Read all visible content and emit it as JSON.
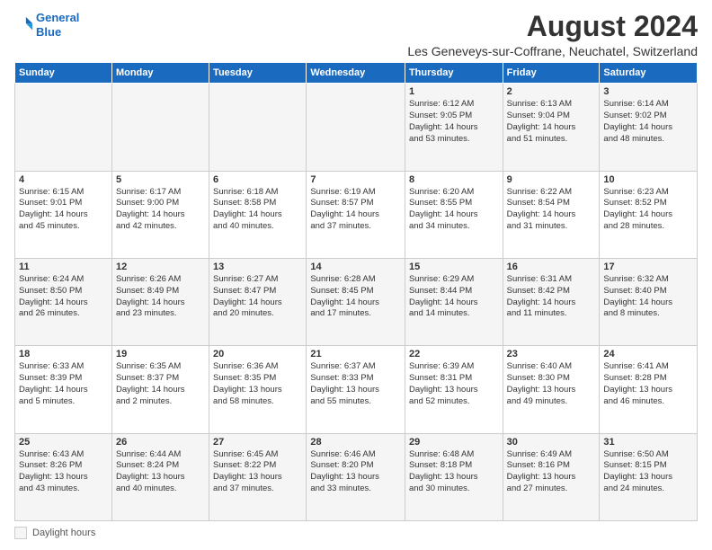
{
  "logo": {
    "line1": "General",
    "line2": "Blue"
  },
  "title": "August 2024",
  "subtitle": "Les Geneveys-sur-Coffrane, Neuchatel, Switzerland",
  "days_of_week": [
    "Sunday",
    "Monday",
    "Tuesday",
    "Wednesday",
    "Thursday",
    "Friday",
    "Saturday"
  ],
  "footer": {
    "label": "Daylight hours"
  },
  "weeks": [
    [
      {
        "day": "",
        "info": ""
      },
      {
        "day": "",
        "info": ""
      },
      {
        "day": "",
        "info": ""
      },
      {
        "day": "",
        "info": ""
      },
      {
        "day": "1",
        "info": "Sunrise: 6:12 AM\nSunset: 9:05 PM\nDaylight: 14 hours\nand 53 minutes."
      },
      {
        "day": "2",
        "info": "Sunrise: 6:13 AM\nSunset: 9:04 PM\nDaylight: 14 hours\nand 51 minutes."
      },
      {
        "day": "3",
        "info": "Sunrise: 6:14 AM\nSunset: 9:02 PM\nDaylight: 14 hours\nand 48 minutes."
      }
    ],
    [
      {
        "day": "4",
        "info": "Sunrise: 6:15 AM\nSunset: 9:01 PM\nDaylight: 14 hours\nand 45 minutes."
      },
      {
        "day": "5",
        "info": "Sunrise: 6:17 AM\nSunset: 9:00 PM\nDaylight: 14 hours\nand 42 minutes."
      },
      {
        "day": "6",
        "info": "Sunrise: 6:18 AM\nSunset: 8:58 PM\nDaylight: 14 hours\nand 40 minutes."
      },
      {
        "day": "7",
        "info": "Sunrise: 6:19 AM\nSunset: 8:57 PM\nDaylight: 14 hours\nand 37 minutes."
      },
      {
        "day": "8",
        "info": "Sunrise: 6:20 AM\nSunset: 8:55 PM\nDaylight: 14 hours\nand 34 minutes."
      },
      {
        "day": "9",
        "info": "Sunrise: 6:22 AM\nSunset: 8:54 PM\nDaylight: 14 hours\nand 31 minutes."
      },
      {
        "day": "10",
        "info": "Sunrise: 6:23 AM\nSunset: 8:52 PM\nDaylight: 14 hours\nand 28 minutes."
      }
    ],
    [
      {
        "day": "11",
        "info": "Sunrise: 6:24 AM\nSunset: 8:50 PM\nDaylight: 14 hours\nand 26 minutes."
      },
      {
        "day": "12",
        "info": "Sunrise: 6:26 AM\nSunset: 8:49 PM\nDaylight: 14 hours\nand 23 minutes."
      },
      {
        "day": "13",
        "info": "Sunrise: 6:27 AM\nSunset: 8:47 PM\nDaylight: 14 hours\nand 20 minutes."
      },
      {
        "day": "14",
        "info": "Sunrise: 6:28 AM\nSunset: 8:45 PM\nDaylight: 14 hours\nand 17 minutes."
      },
      {
        "day": "15",
        "info": "Sunrise: 6:29 AM\nSunset: 8:44 PM\nDaylight: 14 hours\nand 14 minutes."
      },
      {
        "day": "16",
        "info": "Sunrise: 6:31 AM\nSunset: 8:42 PM\nDaylight: 14 hours\nand 11 minutes."
      },
      {
        "day": "17",
        "info": "Sunrise: 6:32 AM\nSunset: 8:40 PM\nDaylight: 14 hours\nand 8 minutes."
      }
    ],
    [
      {
        "day": "18",
        "info": "Sunrise: 6:33 AM\nSunset: 8:39 PM\nDaylight: 14 hours\nand 5 minutes."
      },
      {
        "day": "19",
        "info": "Sunrise: 6:35 AM\nSunset: 8:37 PM\nDaylight: 14 hours\nand 2 minutes."
      },
      {
        "day": "20",
        "info": "Sunrise: 6:36 AM\nSunset: 8:35 PM\nDaylight: 13 hours\nand 58 minutes."
      },
      {
        "day": "21",
        "info": "Sunrise: 6:37 AM\nSunset: 8:33 PM\nDaylight: 13 hours\nand 55 minutes."
      },
      {
        "day": "22",
        "info": "Sunrise: 6:39 AM\nSunset: 8:31 PM\nDaylight: 13 hours\nand 52 minutes."
      },
      {
        "day": "23",
        "info": "Sunrise: 6:40 AM\nSunset: 8:30 PM\nDaylight: 13 hours\nand 49 minutes."
      },
      {
        "day": "24",
        "info": "Sunrise: 6:41 AM\nSunset: 8:28 PM\nDaylight: 13 hours\nand 46 minutes."
      }
    ],
    [
      {
        "day": "25",
        "info": "Sunrise: 6:43 AM\nSunset: 8:26 PM\nDaylight: 13 hours\nand 43 minutes."
      },
      {
        "day": "26",
        "info": "Sunrise: 6:44 AM\nSunset: 8:24 PM\nDaylight: 13 hours\nand 40 minutes."
      },
      {
        "day": "27",
        "info": "Sunrise: 6:45 AM\nSunset: 8:22 PM\nDaylight: 13 hours\nand 37 minutes."
      },
      {
        "day": "28",
        "info": "Sunrise: 6:46 AM\nSunset: 8:20 PM\nDaylight: 13 hours\nand 33 minutes."
      },
      {
        "day": "29",
        "info": "Sunrise: 6:48 AM\nSunset: 8:18 PM\nDaylight: 13 hours\nand 30 minutes."
      },
      {
        "day": "30",
        "info": "Sunrise: 6:49 AM\nSunset: 8:16 PM\nDaylight: 13 hours\nand 27 minutes."
      },
      {
        "day": "31",
        "info": "Sunrise: 6:50 AM\nSunset: 8:15 PM\nDaylight: 13 hours\nand 24 minutes."
      }
    ]
  ]
}
